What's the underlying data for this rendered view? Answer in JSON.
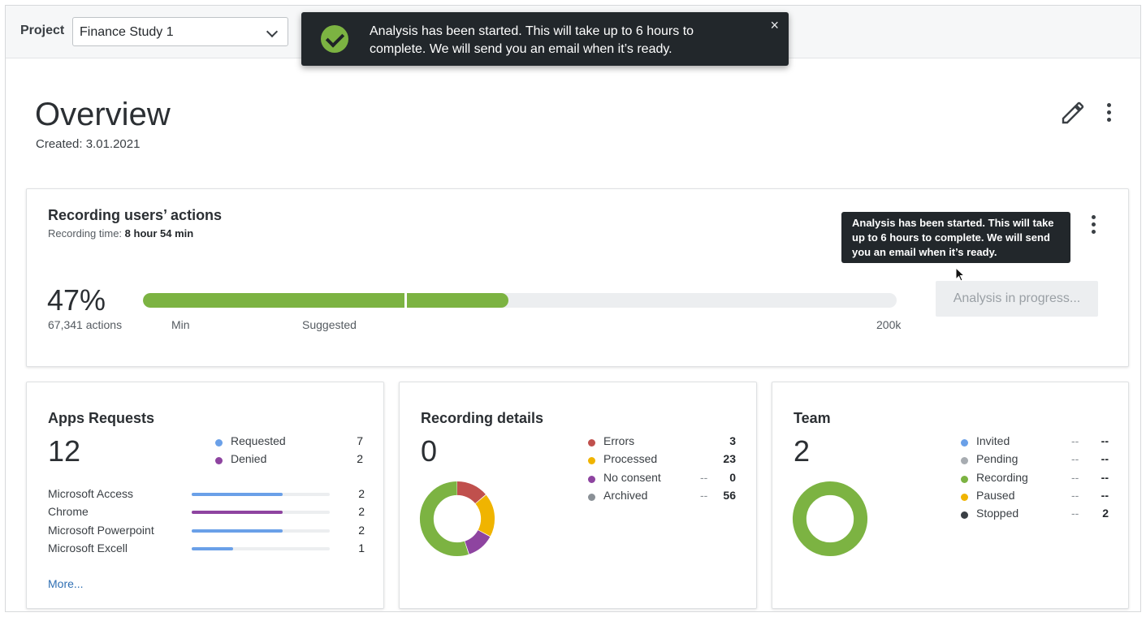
{
  "topbar": {
    "project_label": "Project",
    "project_value": "Finance Study 1"
  },
  "toast": {
    "message": "Analysis has been started. This will take up to 6 hours to complete. We will send you an email when it’s ready.",
    "close": "×"
  },
  "page": {
    "title": "Overview",
    "created_label": "Created:",
    "created_value": "3.01.2021"
  },
  "recording": {
    "title": "Recording users’ actions",
    "time_label": "Recording time:",
    "time_value": "8 hour 54 min",
    "percent": "47%",
    "progress_fraction": 0.485,
    "actions": "67,341 actions",
    "scale_min": "Min",
    "scale_suggested": "Suggested",
    "scale_max": "200k",
    "tooltip": "Analysis has been started. This will take up to 6 hours to complete. We will send you an email when it’s ready.",
    "button": "Analysis in progress..."
  },
  "apps": {
    "title": "Apps Requests",
    "total": "12",
    "legend": [
      {
        "label": "Requested",
        "value": "7",
        "color": "#6aa0e8"
      },
      {
        "label": "Denied",
        "value": "2",
        "color": "#8e44a0"
      }
    ],
    "items": [
      {
        "name": "Microsoft Access",
        "value": "2",
        "fraction": 0.66,
        "color": "#6aa0e8"
      },
      {
        "name": "Chrome",
        "value": "2",
        "fraction": 0.66,
        "color": "#8e44a0"
      },
      {
        "name": "Microsoft Powerpoint",
        "value": "2",
        "fraction": 0.66,
        "color": "#6aa0e8"
      },
      {
        "name": "Microsoft Excell",
        "value": "1",
        "fraction": 0.3,
        "color": "#6aa0e8"
      }
    ],
    "more": "More..."
  },
  "details": {
    "title": "Recording details",
    "total": "0",
    "legend": [
      {
        "label": "Errors",
        "dash": "",
        "value": "3",
        "color": "#c0504d"
      },
      {
        "label": "Processed",
        "dash": "",
        "value": "23",
        "color": "#f0b400"
      },
      {
        "label": "No consent",
        "dash": "--",
        "value": "0",
        "color": "#8e44a0"
      },
      {
        "label": "Archived",
        "dash": "--",
        "value": "56",
        "color": "#8a9096"
      }
    ],
    "donut": [
      {
        "label": "Errors",
        "fraction": 0.14,
        "color": "#c0504d"
      },
      {
        "label": "Processed",
        "fraction": 0.19,
        "color": "#f0b400"
      },
      {
        "label": "No consent",
        "fraction": 0.12,
        "color": "#8e44a0"
      },
      {
        "label": "Archived",
        "fraction": 0.55,
        "color": "#7cb342"
      }
    ]
  },
  "team": {
    "title": "Team",
    "total": "2",
    "legend": [
      {
        "label": "Invited",
        "dash": "--",
        "value": "--",
        "color": "#6aa0e8"
      },
      {
        "label": "Pending",
        "dash": "--",
        "value": "--",
        "color": "#a7acb1"
      },
      {
        "label": "Recording",
        "dash": "--",
        "value": "--",
        "color": "#7cb342"
      },
      {
        "label": "Paused",
        "dash": "--",
        "value": "--",
        "color": "#f0b400"
      },
      {
        "label": "Stopped",
        "dash": "--",
        "value": "2",
        "color": "#3a3f44"
      }
    ],
    "donut_color": "#7cb342"
  }
}
